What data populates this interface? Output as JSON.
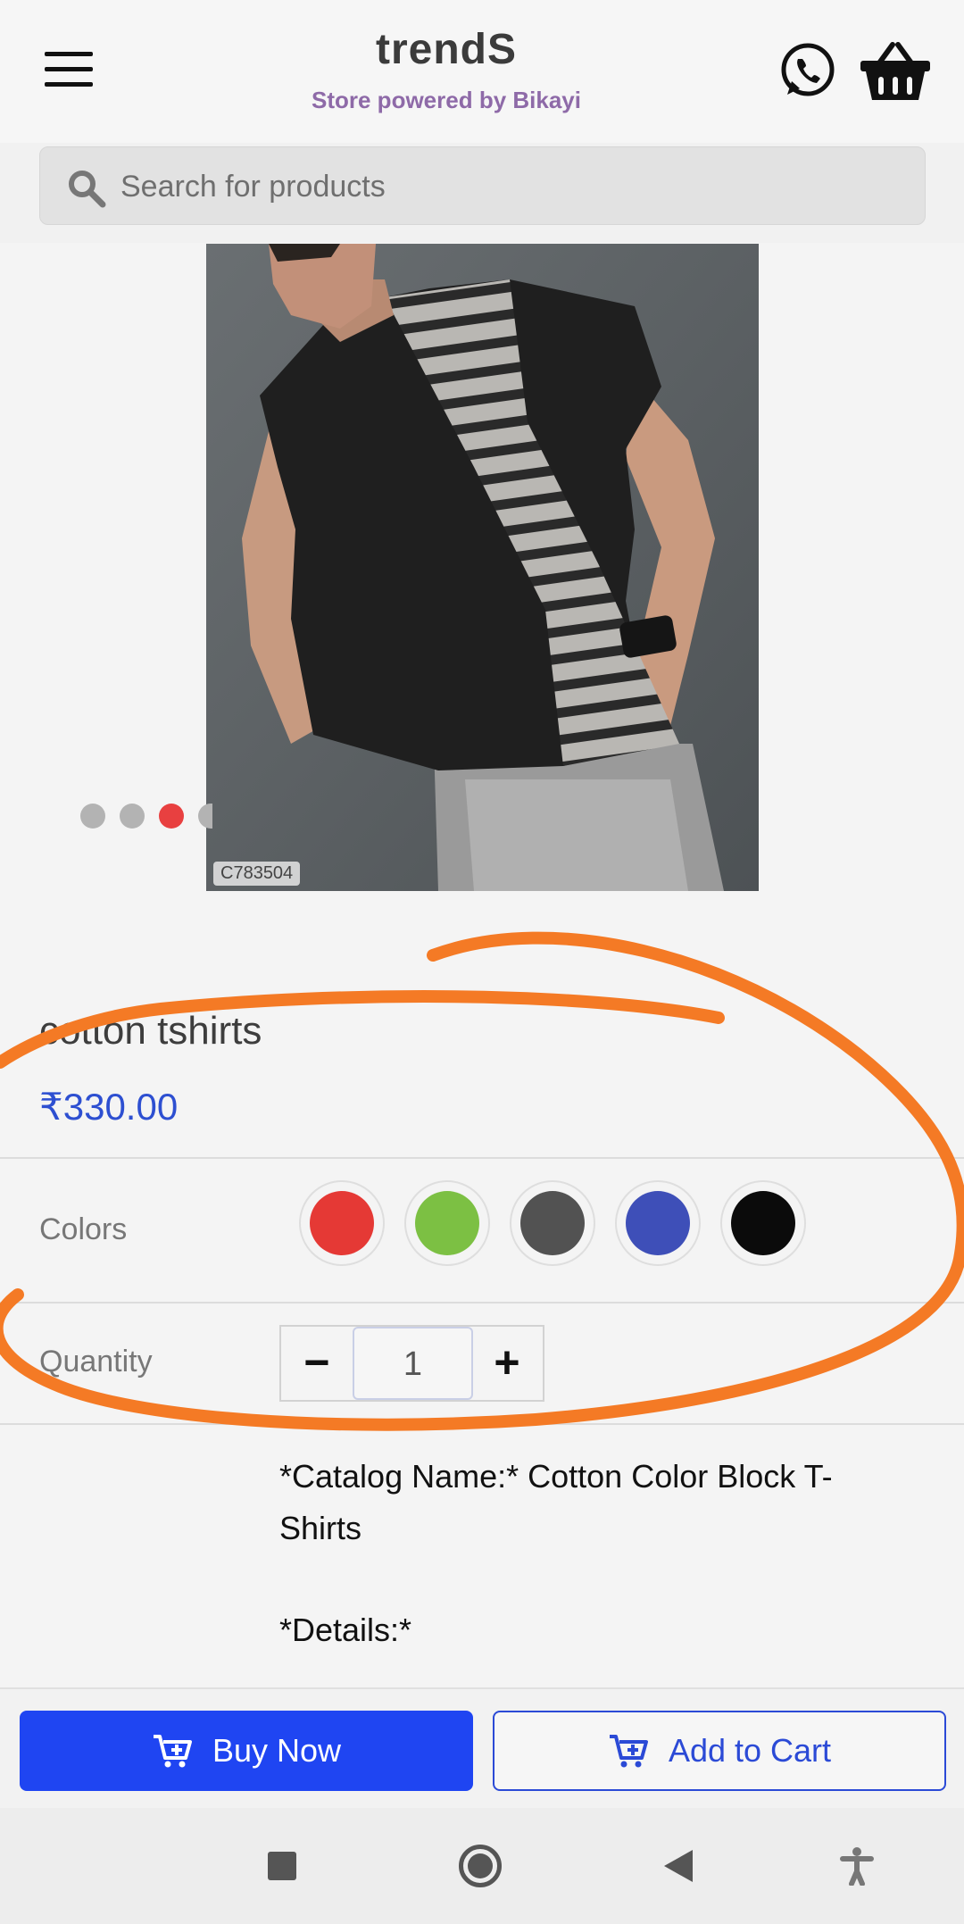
{
  "header": {
    "title": "trendS",
    "subtitle": "Store powered by Bikayi",
    "menu_icon": "menu-icon",
    "whatsapp_icon": "whatsapp-icon",
    "cart_icon": "basket-icon"
  },
  "search": {
    "placeholder": "Search for products",
    "icon": "search-icon"
  },
  "product": {
    "image_alt": "Man wearing black and grey striped cotton t-shirt",
    "sku": "C783504",
    "carousel_active_index": 2,
    "title": "cotton tshirts",
    "price": "₹330.00",
    "colors_label": "Colors",
    "colors": [
      {
        "name": "red",
        "hex": "#e53935"
      },
      {
        "name": "green",
        "hex": "#7cc043"
      },
      {
        "name": "dark-grey",
        "hex": "#525252"
      },
      {
        "name": "blue",
        "hex": "#3e4fb8"
      },
      {
        "name": "black",
        "hex": "#0b0b0b"
      }
    ],
    "quantity_label": "Quantity",
    "quantity": "1",
    "quantity_minus": "−",
    "quantity_plus": "+",
    "description": {
      "catalog": "*Catalog Name:* Cotton Color Block T-Shirts",
      "details": "*Details:*"
    }
  },
  "actions": {
    "buy_now": "Buy Now",
    "add_to_cart": "Add to Cart"
  },
  "colors": {
    "accent_blue": "#1f45f2",
    "price_blue": "#2d4fd1",
    "subtitle_purple": "#8e6aa8",
    "active_dot": "#e84040",
    "annotation_orange": "#f47a25"
  }
}
